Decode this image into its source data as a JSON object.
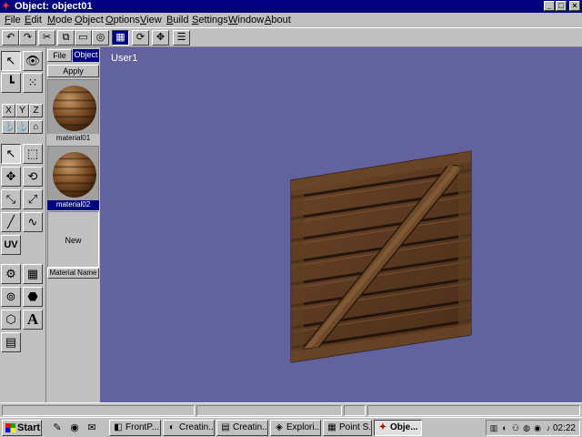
{
  "window": {
    "title": "Object: object01",
    "title_icon": "app-icon",
    "controls": [
      "_",
      "□",
      "×"
    ]
  },
  "menu": [
    "File",
    "Edit",
    "Mode",
    "Object",
    "Options",
    "View",
    "Build",
    "Settings",
    "Window",
    "About"
  ],
  "toolbar": {
    "icons": [
      "undo-icon",
      "redo-icon",
      "cut-icon",
      "copy-icon",
      "paste-icon",
      "render-icon",
      "grid-icon",
      "rotate-view-icon",
      "move-view-icon",
      "list-icon"
    ],
    "glyphs": [
      "↶",
      "↷",
      "✂",
      "⧉",
      "▭",
      "◎",
      "▦",
      "⟳",
      "✥",
      "☰"
    ]
  },
  "tools": {
    "glyphs": [
      "↖",
      "👁",
      "┗",
      "⁙",
      "X",
      "Y",
      "Z",
      "⚓",
      "⚓",
      "⌂",
      "↖",
      "⬚",
      "✥",
      "⟲",
      "⤡",
      "⤢",
      "╱",
      "∿",
      "UV",
      "",
      "⚙",
      "▦",
      "⊚",
      "⬣",
      "⬡",
      "A",
      "▤"
    ]
  },
  "materials": {
    "tabs": [
      "File",
      "Object"
    ],
    "apply_label": "Apply",
    "items": [
      {
        "name": "material01"
      },
      {
        "name": "material02"
      }
    ],
    "new_label": "New",
    "name_label": "Material Name"
  },
  "viewport": {
    "label": "User1",
    "background": "#62629e"
  },
  "taskbar": {
    "start_label": "Start",
    "quick_glyphs": [
      "✎",
      "◉",
      "✉"
    ],
    "tasks": [
      {
        "label": "FrontP...",
        "icon": "◧"
      },
      {
        "label": "Creatin...",
        "icon": "◐"
      },
      {
        "label": "Creatin...",
        "icon": "▤"
      },
      {
        "label": "Explori...",
        "icon": "◈"
      },
      {
        "label": "Point S...",
        "icon": "▦"
      },
      {
        "label": "Obje...",
        "icon": "✦"
      }
    ],
    "tray_glyphs": [
      "▥",
      "◐",
      "⚇",
      "◍",
      "◉",
      "♪"
    ],
    "clock": "02:22"
  }
}
